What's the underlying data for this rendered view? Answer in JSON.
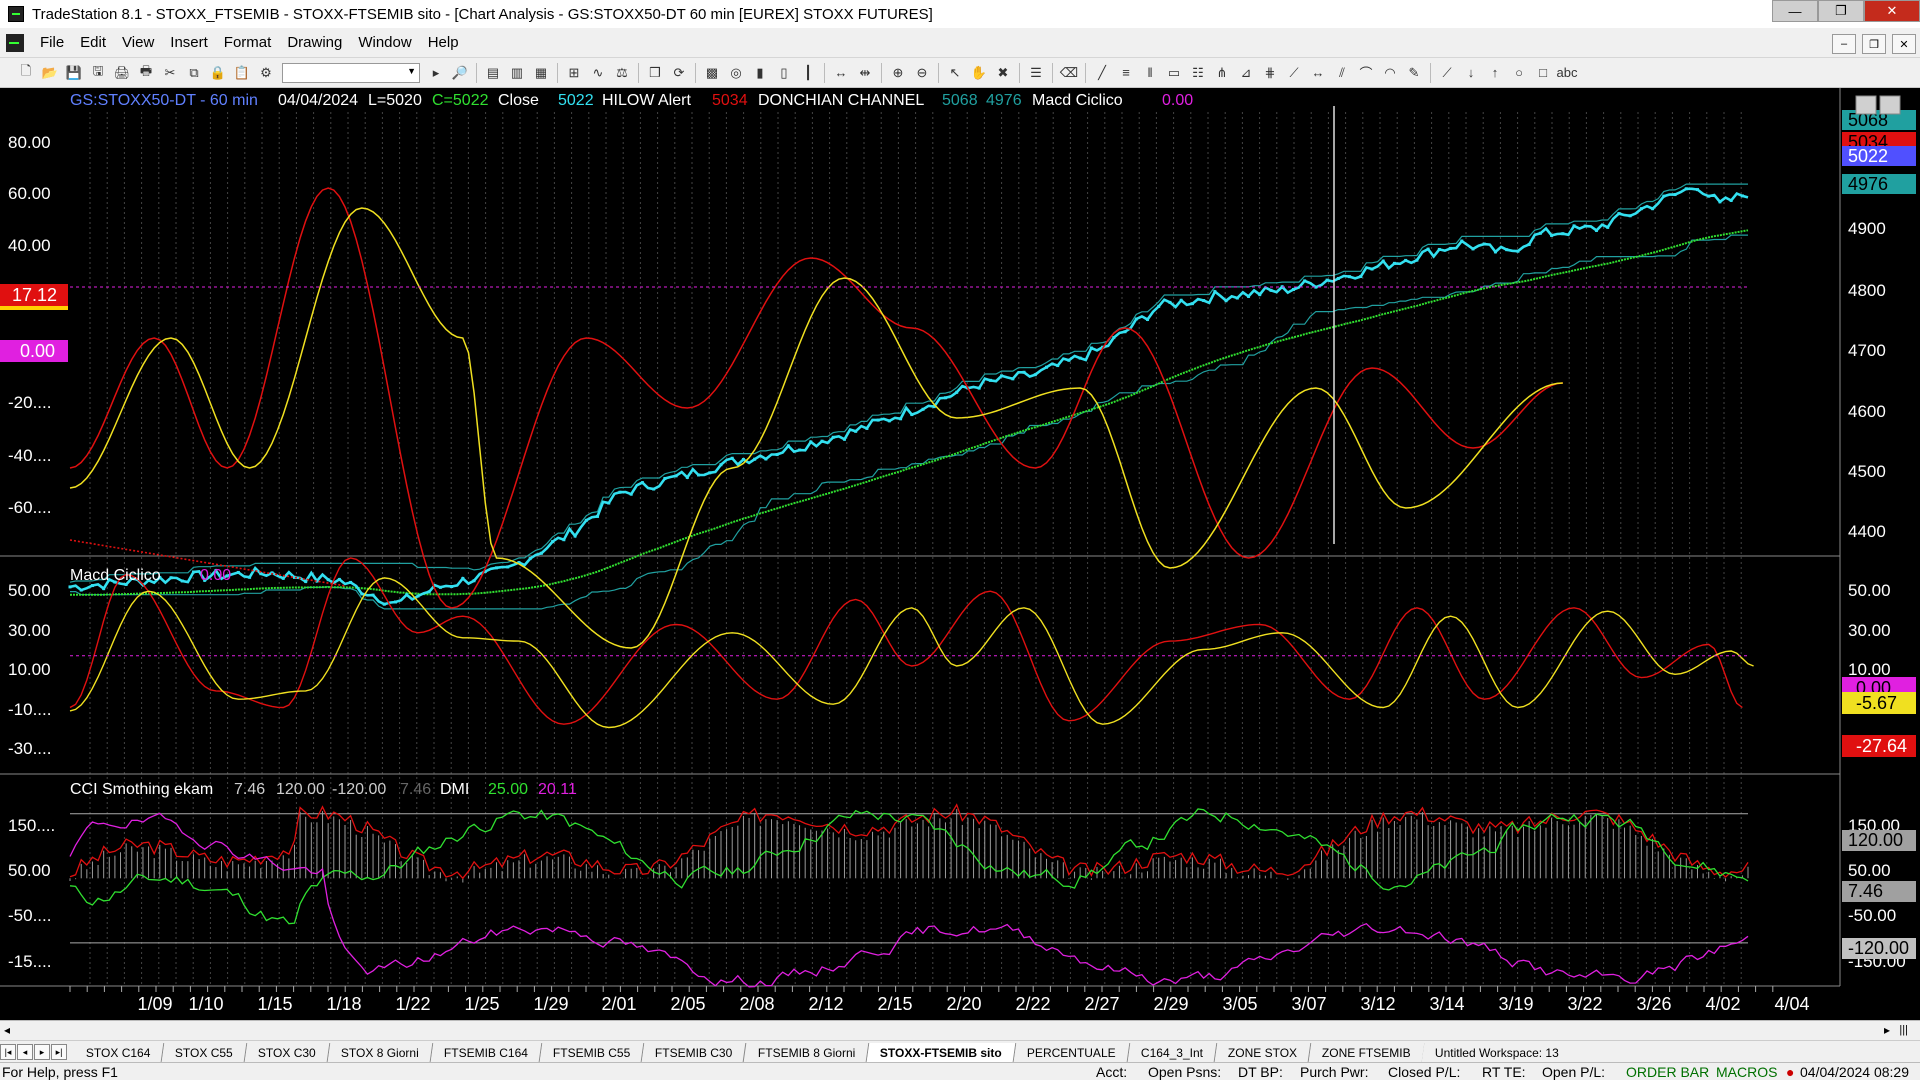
{
  "window": {
    "title": "TradeStation 8.1 - STOXX_FTSEMIB - STOXX-FTSEMIB sito - [Chart Analysis - GS:STOXX50-DT  60 min  [EUREX] STOXX FUTURES]",
    "min_label": "—",
    "max_label": "❐",
    "close_label": "✕"
  },
  "menu": {
    "items": [
      "File",
      "Edit",
      "View",
      "Insert",
      "Format",
      "Drawing",
      "Window",
      "Help"
    ],
    "mdi_buttons": [
      "–",
      "❐",
      "✕"
    ]
  },
  "toolbar": {
    "icons": [
      "new-icon",
      "open-icon",
      "save-icon",
      "save-all-icon",
      "print-setup-icon",
      "print-icon",
      "cut-icon",
      "copy-icon",
      "lock-icon",
      "paste-icon",
      "format-icon"
    ],
    "icons2": [
      "find-icon",
      "sep",
      "bar-icon",
      "bar2-icon",
      "table-icon",
      "sep",
      "insert-icon",
      "indicator-icon",
      "strategy-icon",
      "sep",
      "window-icon",
      "refresh-icon",
      "sep",
      "grid-icon",
      "zoom-icon",
      "chart-icon",
      "chart2-icon",
      "chart3-icon",
      "sep",
      "expand-icon",
      "contract-icon",
      "sep",
      "zoom-in-icon",
      "zoom-out-icon",
      "sep",
      "pointer-icon",
      "hand-icon",
      "tools-icon",
      "sep",
      "properties-icon",
      "sep",
      "delete-icon",
      "sep",
      "trendline-icon",
      "hlines-icon",
      "vlines-icon",
      "channel-icon",
      "fib-icon",
      "andrews-icon",
      "gann-icon",
      "gann2-icon",
      "regression-icon",
      "arrow-both-icon",
      "parallel-icon",
      "speed-icon",
      "arc-icon",
      "pencil-icon",
      "sep",
      "line-icon",
      "arrow-down-icon",
      "arrow-up-icon",
      "ellipse-icon",
      "rectangle-icon",
      "text-icon"
    ],
    "glyphs": {
      "new-icon": "🗋",
      "open-icon": "📂",
      "save-icon": "💾",
      "save-all-icon": "🖫",
      "print-setup-icon": "🖨",
      "print-icon": "🖶",
      "cut-icon": "✂",
      "copy-icon": "⧉",
      "lock-icon": "🔒",
      "paste-icon": "📋",
      "format-icon": "⚙",
      "find-icon": "🔎",
      "bar-icon": "▤",
      "bar2-icon": "▥",
      "table-icon": "▦",
      "insert-icon": "⊞",
      "indicator-icon": "∿",
      "strategy-icon": "⚖",
      "window-icon": "❒",
      "refresh-icon": "⟳",
      "grid-icon": "▩",
      "zoom-icon": "◎",
      "chart-icon": "▮",
      "chart2-icon": "▯",
      "chart3-icon": "┃",
      "expand-icon": "↔",
      "contract-icon": "⇹",
      "zoom-in-icon": "⊕",
      "zoom-out-icon": "⊖",
      "pointer-icon": "↖",
      "hand-icon": "✋",
      "tools-icon": "✖",
      "properties-icon": "☰",
      "delete-icon": "⌫",
      "trendline-icon": "╱",
      "hlines-icon": "≡",
      "vlines-icon": "‖",
      "channel-icon": "▭",
      "fib-icon": "☷",
      "andrews-icon": "⋔",
      "gann-icon": "⊿",
      "gann2-icon": "⋕",
      "regression-icon": "⟋",
      "arrow-both-icon": "↔",
      "parallel-icon": "⫽",
      "speed-icon": "⌒",
      "arc-icon": "◠",
      "pencil-icon": "✎",
      "line-icon": "⟋",
      "arrow-down-icon": "↓",
      "arrow-up-icon": "↑",
      "ellipse-icon": "○",
      "rectangle-icon": "□",
      "text-icon": "abc"
    }
  },
  "chart": {
    "header": {
      "symbol": "GS:STOXX50-DT - 60 min",
      "date": "04/04/2024",
      "low": "L=5020",
      "close_val": "C=5022",
      "close_label": "Close",
      "close_num": "5022",
      "hilow_label": "HILOW Alert",
      "hilow_num": "5034",
      "donchian_label": "DONCHIAN CHANNEL",
      "donchian_up": "5068",
      "donchian_low": "4976",
      "macd_label": "Macd Ciclico",
      "macd_num": "0.00"
    },
    "colors": {
      "price": "#33e0f0",
      "red": "#e01010",
      "yellow": "#f0e020",
      "green": "#30e030",
      "channel": "#20a0a0",
      "magenta": "#e020e0",
      "grid": "#444444",
      "axis_text": "#ffffff"
    },
    "panel1": {
      "left_ticks": [
        "80.00",
        "60.00",
        "40.00",
        "20.00",
        "0.00",
        "-20....",
        "-40....",
        "-60...."
      ],
      "right_ticks": [
        "4900",
        "4800",
        "4700",
        "4600",
        "4500",
        "4400"
      ],
      "right_flags": [
        "5068",
        "5034",
        "5022",
        "4976"
      ],
      "left_flags": [
        "17.12",
        "0.00"
      ]
    },
    "panel2": {
      "title": "Macd Ciclico",
      "value": "0.00",
      "left_ticks": [
        "50.00",
        "30.00",
        "10.00",
        "-10....",
        "-30...."
      ],
      "right_ticks": [
        "50.00",
        "30.00",
        "10.00"
      ],
      "right_flags": [
        "0.00",
        "-5.67",
        "-27.64"
      ]
    },
    "panel3": {
      "title": "CCI Smothing ekam",
      "v1": "7.46",
      "v2": "120.00",
      "v3": "-120.00",
      "v4": "7.46",
      "dmi_label": "DMI",
      "dmi_plus": "25.00",
      "dmi_minus": "20.11",
      "left_ticks": [
        "150....",
        "50.00",
        "-50....",
        "-15...."
      ],
      "right_ticks": [
        "150.00",
        "50.00",
        "-50.00",
        "-150.00"
      ],
      "right_flags": [
        "120.00",
        "7.46",
        "-120.00"
      ]
    },
    "xaxis": [
      "1/09",
      "1/10",
      "1/15",
      "1/18",
      "1/22",
      "1/25",
      "1/29",
      "2/01",
      "2/05",
      "2/08",
      "2/12",
      "2/15",
      "2/20",
      "2/22",
      "2/27",
      "2/29",
      "3/05",
      "3/07",
      "3/12",
      "3/14",
      "3/19",
      "3/22",
      "3/26",
      "4/02",
      "4/04"
    ]
  },
  "tabs": [
    "STOX C164",
    "STOX C55",
    "STOX  C30",
    "STOX  8 Giorni",
    "FTSEMIB C164",
    "FTSEMIB C55",
    "FTSEMIB C30",
    "FTSEMIB  8 Giorni",
    "STOXX-FTSEMIB sito",
    "PERCENTUALE",
    "C164_3_Int",
    "ZONE STOX",
    "ZONE FTSEMIB",
    "Untitled Workspace:  13"
  ],
  "active_tab": 8,
  "status": {
    "help": "For Help, press F1",
    "acct": "Acct:",
    "open_psns": "Open Psns:",
    "dt_bp": "DT BP:",
    "purch_pwr": "Purch Pwr:",
    "closed_pl": "Closed P/L:",
    "rt_te": "RT TE:",
    "open_pl": "Open P/L:",
    "order_bar": "ORDER BAR",
    "macros": "MACROS",
    "datetime": "04/04/2024 08:29"
  }
}
